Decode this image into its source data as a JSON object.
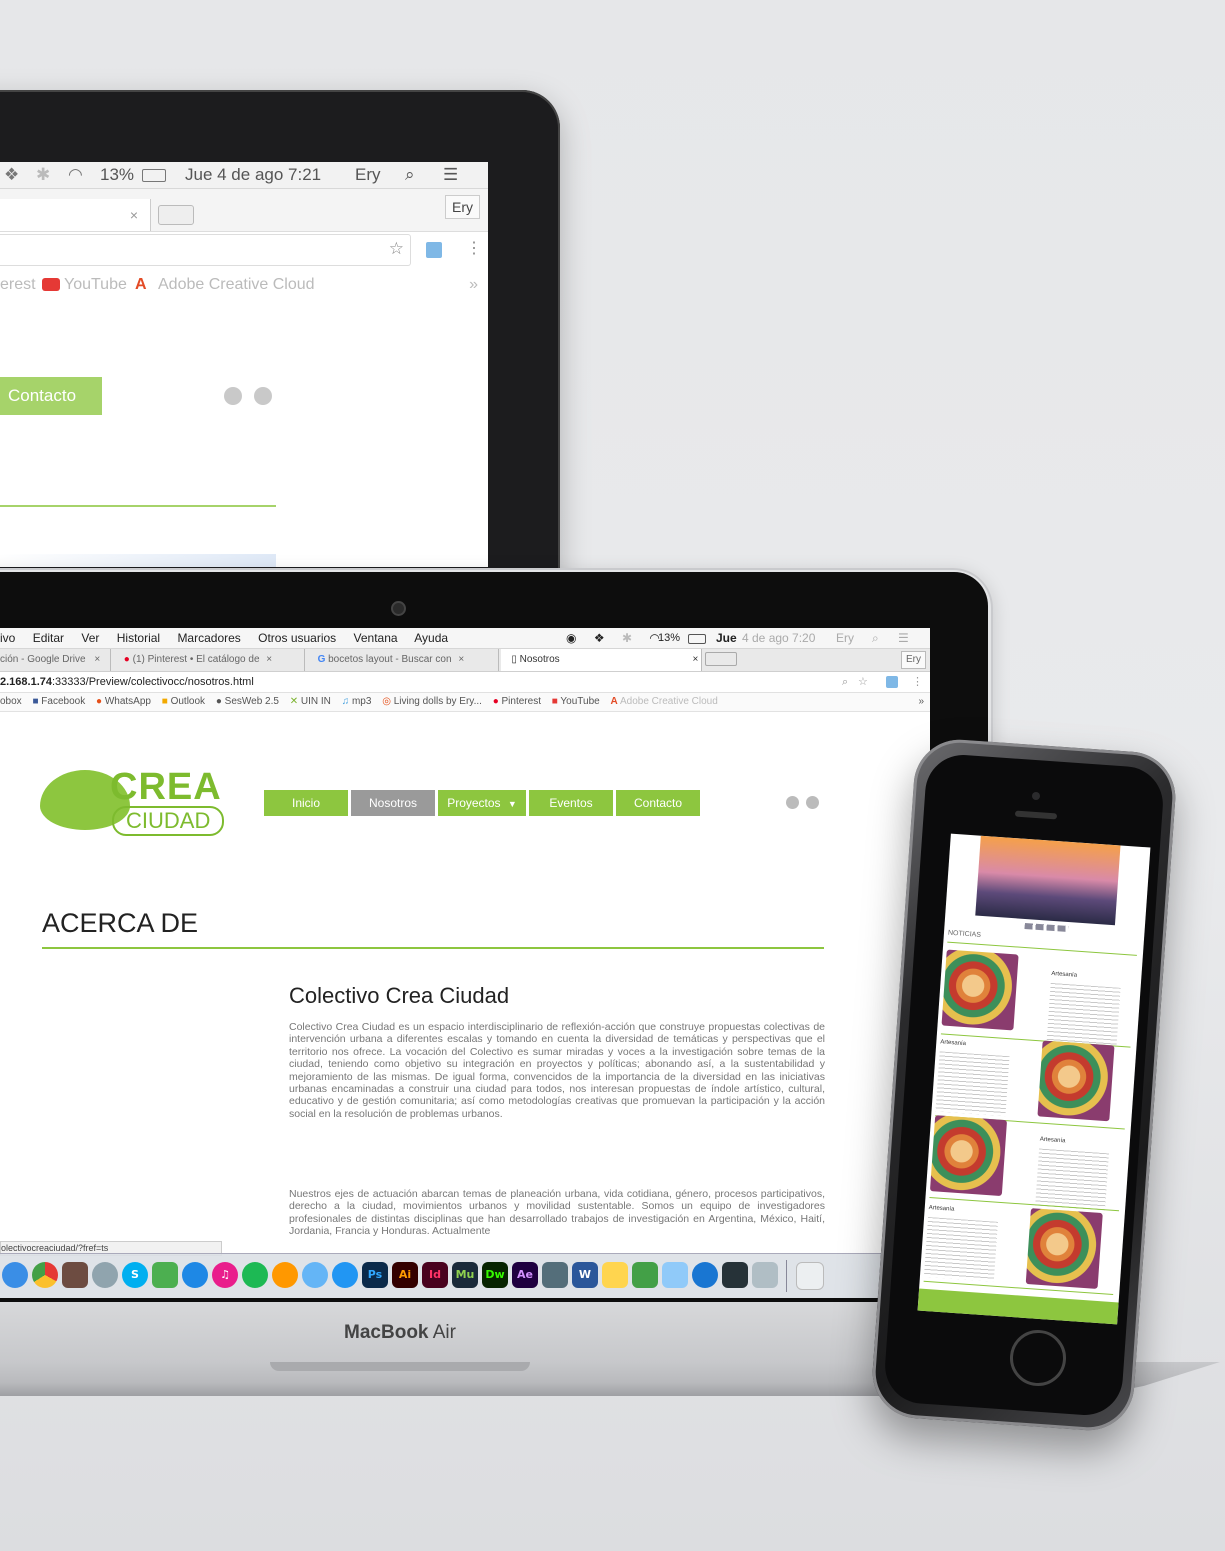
{
  "back_laptop": {
    "menubar": {
      "battery": "13%",
      "clock": "Jue 4 de ago 7:21",
      "user": "Ery"
    },
    "profile_button": "Ery",
    "bookmarks": [
      {
        "label": "erest"
      },
      {
        "label": "YouTube"
      },
      {
        "label": "Adobe Creative Cloud"
      }
    ],
    "overflow": "»",
    "contact_button": "Contacto"
  },
  "front_laptop": {
    "menubar": {
      "items": [
        "ivo",
        "Editar",
        "Ver",
        "Historial",
        "Marcadores",
        "Otros usuarios",
        "Ventana",
        "Ayuda"
      ],
      "battery": "13%",
      "clock_day": "Jue",
      "clock_rest": "4 de ago 7:20",
      "user": "Ery"
    },
    "tabs": [
      {
        "label": "ción - Google Drive"
      },
      {
        "label": "(1) Pinterest • El catálogo de"
      },
      {
        "label": "bocetos layout - Buscar con"
      },
      {
        "label": "Nosotros"
      }
    ],
    "profile_button": "Ery",
    "url": {
      "host": "2.168.1.74",
      "rest": ":33333/Preview/colectivocc/nosotros.html"
    },
    "bookmarks": [
      {
        "label": "obox"
      },
      {
        "label": "Facebook"
      },
      {
        "label": "WhatsApp"
      },
      {
        "label": "Outlook"
      },
      {
        "label": "SesWeb 2.5"
      },
      {
        "label": "UIN IN"
      },
      {
        "label": "mp3"
      },
      {
        "label": "Living dolls by Ery..."
      },
      {
        "label": "Pinterest"
      },
      {
        "label": "YouTube"
      },
      {
        "label": "Adobe Creative Cloud"
      }
    ],
    "site": {
      "logo_line1": "CREA",
      "logo_line2": "CIUDAD",
      "nav": [
        "Inicio",
        "Nosotros",
        "Proyectos",
        "Eventos",
        "Contacto"
      ],
      "nav_active": "Nosotros",
      "page_heading": "ACERCA DE",
      "section_title": "Colectivo Crea Ciudad",
      "paragraph1": "Colectivo Crea Ciudad es un espacio interdisciplinario de reflexión-acción que construye propuestas colectivas de intervención urbana a diferentes escalas y tomando en cuenta la diversidad de temáticas y perspectivas que el territorio nos ofrece. La vocación del Colectivo es sumar miradas y voces a la investigación sobre temas de la ciudad, teniendo como objetivo su integración en proyectos y políticas; abonando así, a la sustentabilidad y mejoramiento de las mismas. De igual forma, convencidos de la importancia de la diversidad en las iniciativas urbanas encaminadas a construir una ciudad para todos, nos interesan propuestas de índole artístico, cultural, educativo y de gestión comunitaria; así como metodologías creativas que promuevan la participación y la acción social en la resolución de problemas urbanos.",
      "paragraph2": "Nuestros ejes de actuación abarcan temas de planeación urbana, vida cotidiana, género, procesos participativos, derecho a la ciudad, movimientos urbanos y movilidad sustentable. Somos un equipo de investigadores profesionales de distintas disciplinas que han desarrollado trabajos de investigación en Argentina, México, Haití, Jordania, Francia y Honduras. Actualmente",
      "status_url": "olectivocreaciudad/?fref=ts"
    },
    "dock_icons": [
      "Ps",
      "Ai",
      "Id",
      "Mu",
      "Dw",
      "Ae",
      "W"
    ],
    "brand": {
      "bold": "MacBook",
      "light": "Air"
    }
  },
  "phone": {
    "section": "NOTICIAS",
    "items": [
      {
        "title": "Artesanía"
      },
      {
        "title": "Artesanía"
      },
      {
        "title": "Artesanía"
      },
      {
        "title": "Artesanía"
      }
    ]
  },
  "colors": {
    "accent": "#8dc63f",
    "nav_active": "#9a9a9a"
  }
}
